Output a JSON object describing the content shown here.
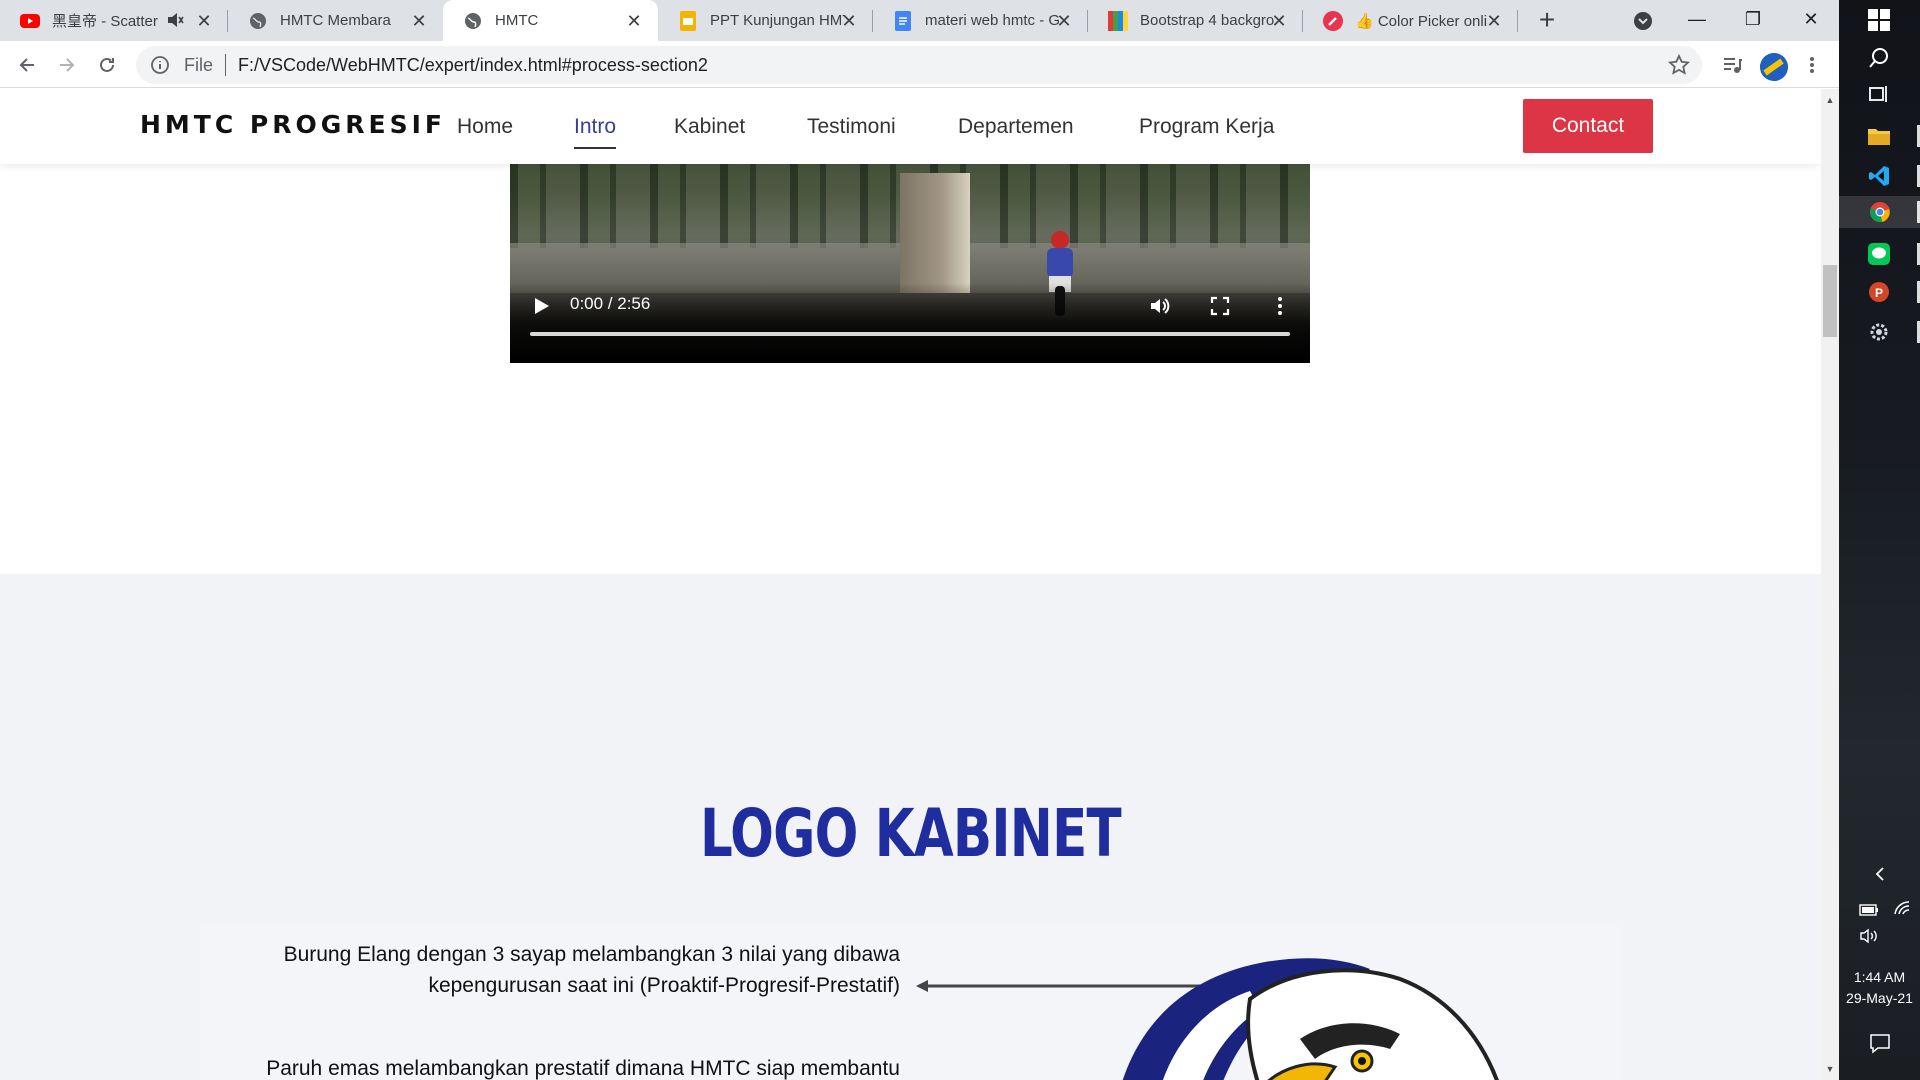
{
  "browser": {
    "tabs": [
      {
        "title": "黑皇帝 - Scatter",
        "icon": "youtube-icon",
        "color": "#ff0000",
        "active": false,
        "muted": true
      },
      {
        "title": "HMTC Membara",
        "icon": "globe-icon",
        "color": "#5f6368",
        "active": false
      },
      {
        "title": "HMTC",
        "icon": "globe-icon",
        "color": "#5f6368",
        "active": true
      },
      {
        "title": "PPT Kunjungan HMT",
        "icon": "slides-icon",
        "color": "#f4b400",
        "active": false
      },
      {
        "title": "materi web hmtc - G",
        "icon": "docs-icon",
        "color": "#4285f4",
        "active": false
      },
      {
        "title": "Bootstrap 4 backgro",
        "icon": "bootstrap-icon",
        "color": "#7952b3",
        "active": false
      },
      {
        "title": "👍 Color Picker onli",
        "icon": "color-picker-icon",
        "color": "#e8344e",
        "active": false
      }
    ],
    "new_tab_symbol": "+",
    "window_controls": {
      "minimize": "—",
      "restore": "❐",
      "close": "✕"
    },
    "address": {
      "scheme": "File",
      "url": "F:/VSCode/WebHMTC/expert/index.html#process-section2"
    }
  },
  "site": {
    "brand": "HMTC PROGRESIF",
    "nav": [
      {
        "label": "Home",
        "active": false
      },
      {
        "label": "Intro",
        "active": true
      },
      {
        "label": "Kabinet",
        "active": false
      },
      {
        "label": "Testimoni",
        "active": false
      },
      {
        "label": "Departemen",
        "active": false
      },
      {
        "label": "Program Kerja",
        "active": false
      }
    ],
    "contact_label": "Contact",
    "colors": {
      "contact": "#dc3545",
      "heading": "#1f2d9e",
      "nav_active": "#3a3f8f"
    },
    "video": {
      "time": "0:00 / 2:56"
    },
    "logo_section": {
      "title": "LOGO KABINET",
      "desc1": "Burung Elang dengan 3 sayap melambangkan 3 nilai yang dibawa kepengurusan saat ini (Proaktif-Progresif-Prestatif)",
      "desc2": "Paruh emas melambangkan prestatif dimana HMTC siap membantu"
    }
  },
  "taskbar": {
    "apps": [
      "windows-start-icon",
      "search-icon",
      "task-view-icon",
      "file-explorer-icon",
      "vscode-icon",
      "chrome-icon",
      "line-icon",
      "powerpoint-icon",
      "settings-icon"
    ],
    "time": "1:44 AM",
    "date": "29-May-21"
  }
}
